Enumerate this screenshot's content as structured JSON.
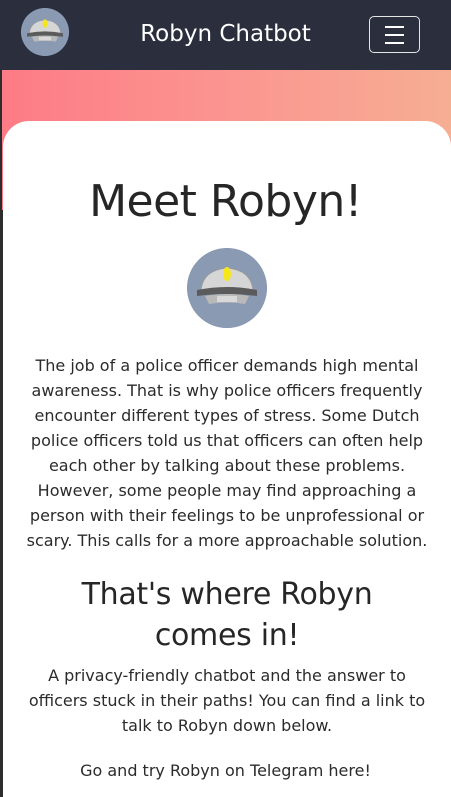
{
  "navbar": {
    "title": "Robyn Chatbot",
    "logo_icon": "police-cap-icon",
    "menu_icon": "hamburger-menu-icon"
  },
  "hero": {
    "heading": "Meet Robyn!",
    "avatar_icon": "police-cap-icon",
    "intro": "The job of a police officer demands high mental awareness. That is why police officers frequently encounter different types of stress. Some Dutch police officers told us that officers can often help each other by talking about these problems. However, some people may find approaching a person with their feelings to be unprofessional or scary. This calls for a more approachable solution."
  },
  "section": {
    "heading": "That's where Robyn comes in!",
    "description": "A privacy-friendly chatbot and the answer to officers stuck in their paths! You can find a link to talk to Robyn down below.",
    "cta_prefix": "Go and try Robyn on ",
    "cta_link": "Telegram here!"
  },
  "colors": {
    "navbar_bg": "#2a2e3d",
    "gradient_start": "#fd7b86",
    "gradient_end": "#f6ae93",
    "avatar_bg": "#8a9ab3",
    "cap_light": "#f5e61a"
  }
}
